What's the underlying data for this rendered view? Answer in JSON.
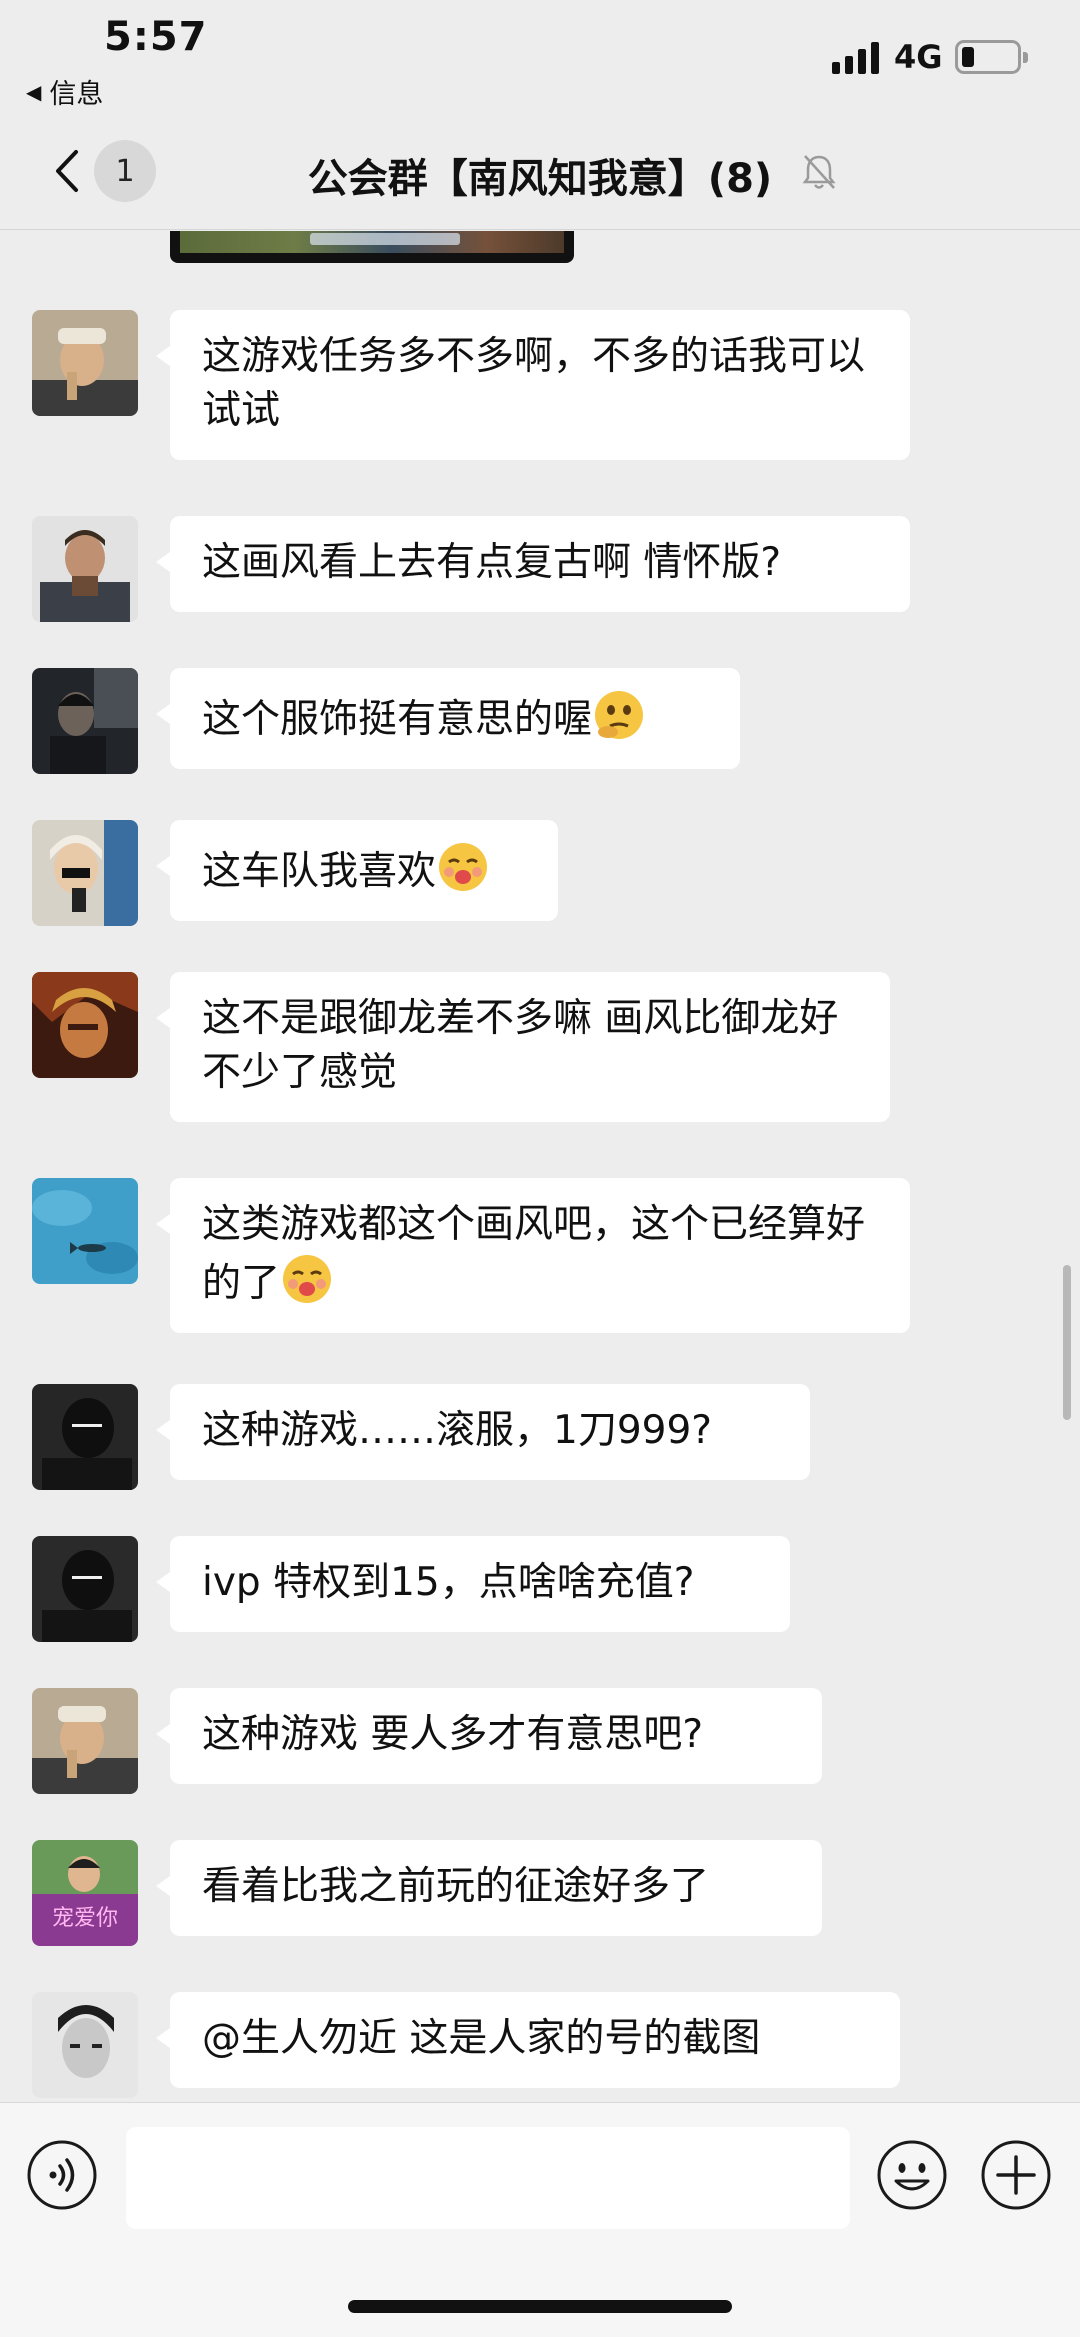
{
  "status_bar": {
    "time": "5:57",
    "back_app": "信息",
    "network": "4G"
  },
  "nav": {
    "unread_count": "1",
    "title": "公会群【南风知我意】(8)"
  },
  "messages": [
    {
      "text": "这游戏任务多不多啊，不多的话我可以试试",
      "avatar_color": "#7a6a58"
    },
    {
      "text": "这画风看上去有点复古啊  情怀版?",
      "avatar_color": "#5b5f66"
    },
    {
      "text": "这个服饰挺有意思的喔",
      "emoji": "thinking-face",
      "avatar_color": "#2d3036"
    },
    {
      "text": "这车队我喜欢",
      "emoji": "kiss-face",
      "avatar_color": "#c9c4bb"
    },
    {
      "text": "这不是跟御龙差不多嘛  画风比御龙好不少了感觉",
      "avatar_color": "#8a3a1a"
    },
    {
      "text": "这类游戏都这个画风吧，这个已经算好的了",
      "emoji": "kiss-face",
      "avatar_color": "#3f9fc8"
    },
    {
      "text": "这种游戏……滚服，1刀999?",
      "avatar_color": "#1e1e1e"
    },
    {
      "text": "ivp 特权到15，点啥啥充值?",
      "avatar_color": "#1e1e1e"
    },
    {
      "text": "这种游戏 要人多才有意思吧?",
      "avatar_color": "#7a6a58"
    },
    {
      "text": "看着比我之前玩的征途好多了",
      "avatar_color": "#8a3a90",
      "avatar_caption": "宠爱你"
    },
    {
      "text": "@生人勿近  这是人家的号的截图",
      "avatar_color": "#dcdcdc"
    }
  ],
  "colors": {
    "background": "#ededed",
    "bubble": "#ffffff",
    "input_bar": "#f6f6f6"
  },
  "icons": {
    "back": "chevron-left-icon",
    "mute": "bell-slash-icon",
    "voice": "voice-icon",
    "emoji": "smiley-icon",
    "plus": "plus-icon"
  }
}
